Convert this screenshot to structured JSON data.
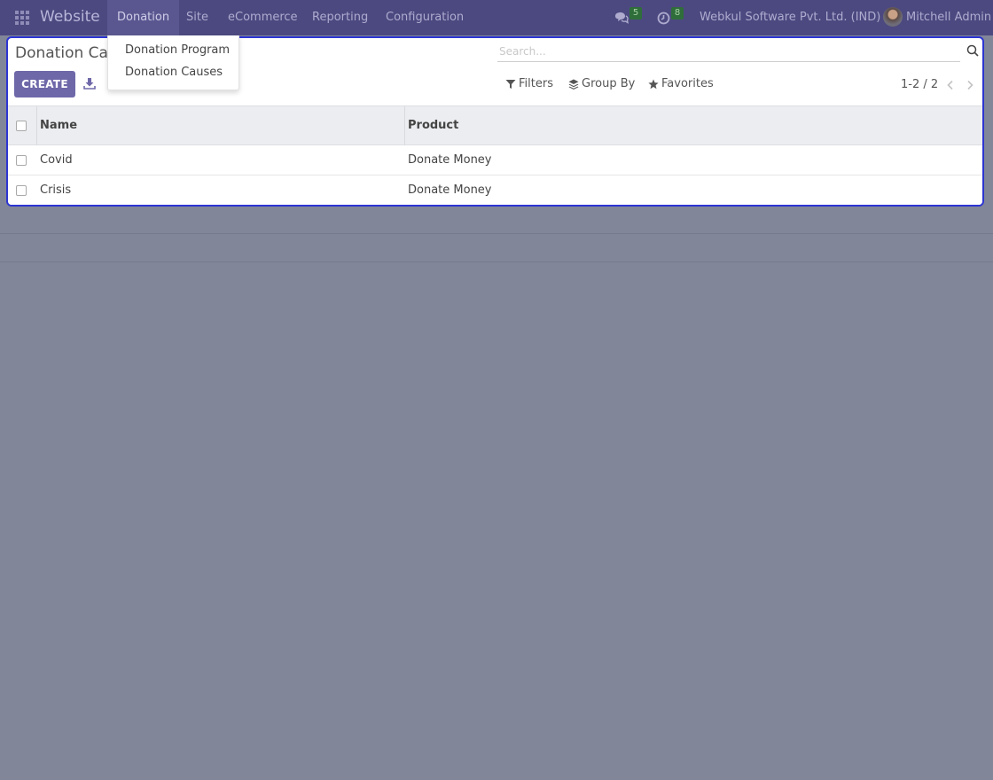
{
  "navbar": {
    "brand": "Website",
    "menu": [
      "Donation",
      "Site",
      "eCommerce",
      "Reporting",
      "Configuration"
    ],
    "active_menu": "Donation",
    "messages_badge": "5",
    "activities_badge": "8",
    "company": "Webkul Software Pvt. Ltd. (IND)",
    "user": "Mitchell Admin"
  },
  "dropdown": {
    "items": [
      "Donation Program",
      "Donation Causes"
    ]
  },
  "control_panel": {
    "title": "Donation Causes",
    "create_label": "CREATE",
    "search_placeholder": "Search...",
    "filters_label": "Filters",
    "groupby_label": "Group By",
    "favorites_label": "Favorites",
    "pager": "1-2 / 2"
  },
  "table": {
    "columns": [
      "Name",
      "Product"
    ],
    "rows": [
      {
        "name": "Covid",
        "product": "Donate Money"
      },
      {
        "name": "Crisis",
        "product": "Donate Money"
      }
    ]
  },
  "colors": {
    "navbar": "#4c4980",
    "accent": "#6e68a9",
    "focus_border": "#2c35d2",
    "backdrop": "#828699"
  }
}
